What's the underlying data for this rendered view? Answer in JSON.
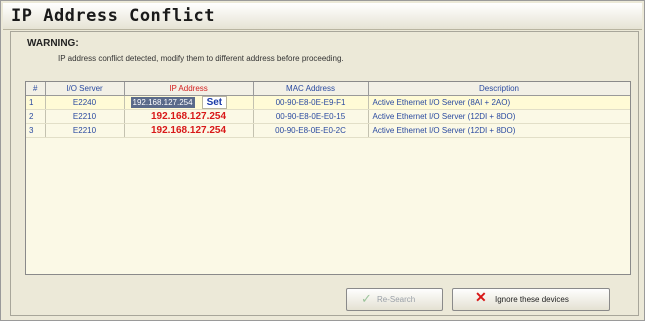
{
  "dialog": {
    "title": "IP Address Conflict",
    "warning_title": "WARNING:",
    "warning_message": "IP address conflict detected, modify them to different address before proceeding."
  },
  "table": {
    "headers": {
      "index": "#",
      "io_server": "I/O Server",
      "ip_address": "IP Address",
      "mac_address": "MAC Address",
      "description": "Description"
    },
    "rows": [
      {
        "index": "1",
        "io_server": "E2240",
        "ip_address": "192.168.127.254",
        "mac_address": "00-90-E8-0E-E9-F1",
        "description": "Active Ethernet I/O Server (8AI + 2AO)"
      },
      {
        "index": "2",
        "io_server": "E2210",
        "ip_address": "192.168.127.254",
        "mac_address": "00-90-E8-0E-E0-15",
        "description": "Active Ethernet I/O Server (12DI + 8DO)"
      },
      {
        "index": "3",
        "io_server": "E2210",
        "ip_address": "192.168.127.254",
        "mac_address": "00-90-E8-0E-E0-2C",
        "description": "Active Ethernet I/O Server (12DI + 8DO)"
      }
    ],
    "set_label": "Set"
  },
  "buttons": {
    "research_label": "Re-Search",
    "ignore_label": "Ignore these devices",
    "research_icon": "checkmark-icon",
    "ignore_icon": "x-icon"
  },
  "colors": {
    "ip_conflict": "#d81818",
    "link_text": "#2a4aa0",
    "selection": "#5a6a8a"
  }
}
